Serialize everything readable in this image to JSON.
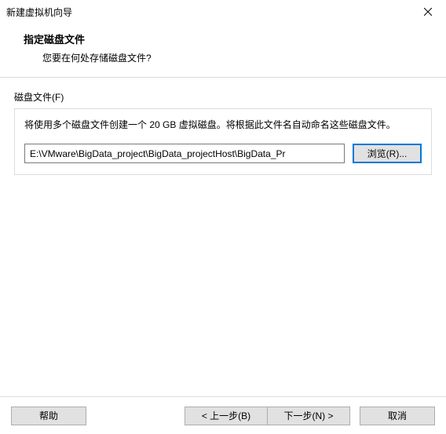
{
  "titlebar": {
    "title": "新建虚拟机向导"
  },
  "header": {
    "title": "指定磁盘文件",
    "subtitle": "您要在何处存储磁盘文件?"
  },
  "group": {
    "label": "磁盘文件(F)",
    "description": "将使用多个磁盘文件创建一个 20 GB 虚拟磁盘。将根据此文件名自动命名这些磁盘文件。",
    "path_value": "E:\\VMware\\BigData_project\\BigData_projectHost\\BigData_Pr",
    "browse_label": "浏览(R)..."
  },
  "footer": {
    "help": "帮助",
    "back": "< 上一步(B)",
    "next": "下一步(N) >",
    "cancel": "取消"
  }
}
